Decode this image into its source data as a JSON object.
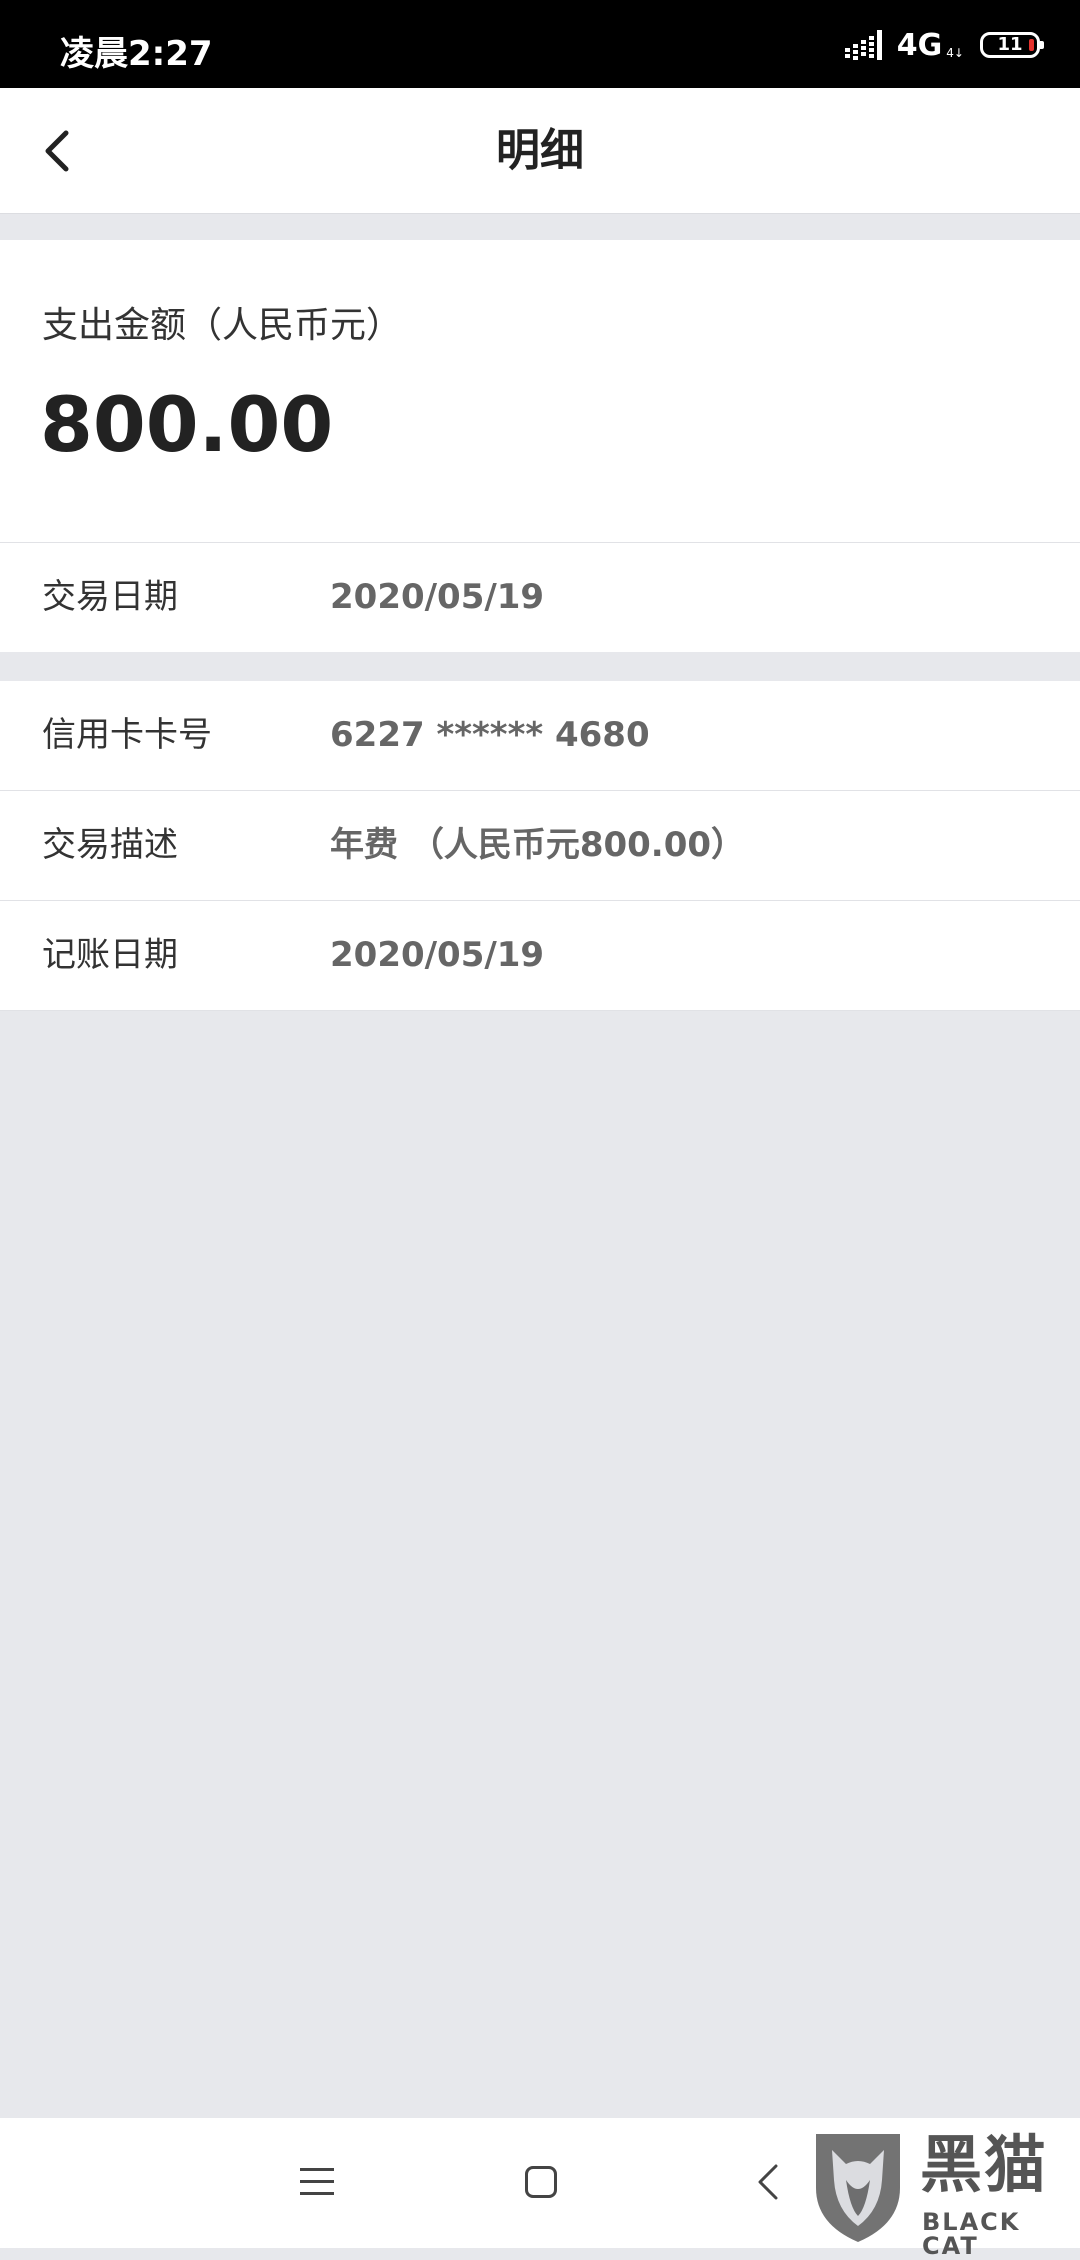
{
  "status_bar": {
    "time": "凌晨2:27",
    "network": "4G",
    "network_sub": "4↓",
    "battery": "11"
  },
  "header": {
    "title": "明细",
    "back_icon": "chevron-left-icon"
  },
  "amount": {
    "label": "支出金额（人民币元）",
    "value": "800.00"
  },
  "details": [
    {
      "label": "交易日期",
      "value": "2020/05/19"
    },
    {
      "label": "信用卡卡号",
      "value": "6227 ****** 4680"
    },
    {
      "label": "交易描述",
      "value": "年费 （人民币元800.00）"
    },
    {
      "label": "记账日期",
      "value": "2020/05/19"
    }
  ],
  "nav": {
    "menu_icon": "menu-icon",
    "home_icon": "home-square-icon",
    "back_icon": "back-chevron-icon"
  },
  "watermark": {
    "name_cn": "黑猫",
    "name_en": "BLACK CAT"
  },
  "colors": {
    "background": "#e7e8ec",
    "card": "#ffffff",
    "status_bar": "#000000",
    "text_primary": "#222222",
    "text_secondary": "#666666",
    "battery_low": "#e5322d"
  }
}
